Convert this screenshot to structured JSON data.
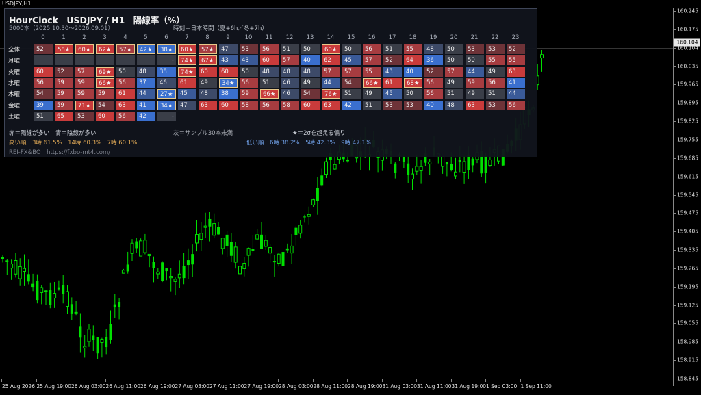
{
  "window": {
    "title": "USDJPY,H1"
  },
  "panel": {
    "title": "HourClock　USDJPY / H1　陽線率（%）",
    "subtitle": "5000本（2025.10.30〜2026.09.01）",
    "time_note": "時刻＝日本時間（夏+6h／冬+7h）",
    "hours": [
      "0",
      "1",
      "2",
      "3",
      "4",
      "5",
      "6",
      "7",
      "8",
      "9",
      "10",
      "11",
      "12",
      "13",
      "14",
      "15",
      "16",
      "17",
      "18",
      "19",
      "20",
      "21",
      "22",
      "23"
    ],
    "rows": [
      {
        "label": "全体",
        "cells": [
          {
            "t": "52",
            "c": "r1"
          },
          {
            "t": "58★",
            "c": "r3",
            "h": true
          },
          {
            "t": "60★",
            "c": "r3",
            "h": true
          },
          {
            "t": "62★",
            "c": "r3",
            "h": true
          },
          {
            "t": "57★",
            "c": "r2",
            "h": true
          },
          {
            "t": "42★",
            "c": "b3",
            "h": true
          },
          {
            "t": "38★",
            "c": "b3",
            "h": true
          },
          {
            "t": "60★",
            "c": "r3",
            "h": true
          },
          {
            "t": "57★",
            "c": "r2",
            "h": true
          },
          {
            "t": "47",
            "c": "b1"
          },
          {
            "t": "53",
            "c": "r1"
          },
          {
            "t": "56",
            "c": "r2"
          },
          {
            "t": "51",
            "c": "n"
          },
          {
            "t": "50",
            "c": "n"
          },
          {
            "t": "60★",
            "c": "r3",
            "h": true
          },
          {
            "t": "50",
            "c": "n"
          },
          {
            "t": "56",
            "c": "r2"
          },
          {
            "t": "51",
            "c": "n"
          },
          {
            "t": "55",
            "c": "r2"
          },
          {
            "t": "48",
            "c": "b1"
          },
          {
            "t": "50",
            "c": "n"
          },
          {
            "t": "53",
            "c": "r1"
          },
          {
            "t": "53",
            "c": "r1"
          },
          {
            "t": "52",
            "c": "r1"
          }
        ]
      },
      {
        "label": "月曜",
        "cells": [
          {
            "t": "",
            "c": "g"
          },
          {
            "t": "",
            "c": "g"
          },
          {
            "t": "",
            "c": "g"
          },
          {
            "t": "",
            "c": "g"
          },
          {
            "t": "",
            "c": "g"
          },
          {
            "t": "",
            "c": "g"
          },
          {
            "t": "-",
            "c": "g"
          },
          {
            "t": "74★",
            "c": "r3",
            "h": true
          },
          {
            "t": "67★",
            "c": "r3",
            "h": true
          },
          {
            "t": "43",
            "c": "b2"
          },
          {
            "t": "43",
            "c": "b2"
          },
          {
            "t": "60",
            "c": "r3"
          },
          {
            "t": "57",
            "c": "r2"
          },
          {
            "t": "40",
            "c": "b3"
          },
          {
            "t": "62",
            "c": "r3"
          },
          {
            "t": "45",
            "c": "b2"
          },
          {
            "t": "57",
            "c": "r2"
          },
          {
            "t": "52",
            "c": "r1"
          },
          {
            "t": "64",
            "c": "r3"
          },
          {
            "t": "36",
            "c": "b3"
          },
          {
            "t": "50",
            "c": "n"
          },
          {
            "t": "50",
            "c": "n"
          },
          {
            "t": "55",
            "c": "r2"
          },
          {
            "t": "55",
            "c": "r2"
          }
        ]
      },
      {
        "label": "火曜",
        "cells": [
          {
            "t": "60",
            "c": "r3"
          },
          {
            "t": "52",
            "c": "r1"
          },
          {
            "t": "57",
            "c": "r2"
          },
          {
            "t": "69★",
            "c": "r3",
            "h": true
          },
          {
            "t": "50",
            "c": "n"
          },
          {
            "t": "48",
            "c": "b1"
          },
          {
            "t": "38",
            "c": "b3"
          },
          {
            "t": "74★",
            "c": "r3",
            "h": true
          },
          {
            "t": "60",
            "c": "r3"
          },
          {
            "t": "60",
            "c": "r3"
          },
          {
            "t": "50",
            "c": "n"
          },
          {
            "t": "48",
            "c": "b1"
          },
          {
            "t": "48",
            "c": "b1"
          },
          {
            "t": "48",
            "c": "b1"
          },
          {
            "t": "57",
            "c": "r2"
          },
          {
            "t": "57",
            "c": "r2"
          },
          {
            "t": "55",
            "c": "r2"
          },
          {
            "t": "43",
            "c": "b2"
          },
          {
            "t": "40",
            "c": "b3"
          },
          {
            "t": "52",
            "c": "r1"
          },
          {
            "t": "57",
            "c": "r2"
          },
          {
            "t": "44",
            "c": "b2"
          },
          {
            "t": "49",
            "c": "n"
          },
          {
            "t": "63",
            "c": "r3"
          }
        ]
      },
      {
        "label": "水曜",
        "cells": [
          {
            "t": "56",
            "c": "r2"
          },
          {
            "t": "59",
            "c": "r2"
          },
          {
            "t": "59",
            "c": "r2"
          },
          {
            "t": "66★",
            "c": "r3",
            "h": true
          },
          {
            "t": "56",
            "c": "r2"
          },
          {
            "t": "37",
            "c": "b3"
          },
          {
            "t": "46",
            "c": "b1"
          },
          {
            "t": "61",
            "c": "r3"
          },
          {
            "t": "49",
            "c": "n"
          },
          {
            "t": "34★",
            "c": "b3",
            "h": true
          },
          {
            "t": "56",
            "c": "r2"
          },
          {
            "t": "51",
            "c": "n"
          },
          {
            "t": "46",
            "c": "b1"
          },
          {
            "t": "49",
            "c": "n"
          },
          {
            "t": "44",
            "c": "b2"
          },
          {
            "t": "54",
            "c": "r1"
          },
          {
            "t": "66★",
            "c": "r3",
            "h": true
          },
          {
            "t": "61",
            "c": "r3"
          },
          {
            "t": "68★",
            "c": "r3",
            "h": true
          },
          {
            "t": "56",
            "c": "r2"
          },
          {
            "t": "49",
            "c": "n"
          },
          {
            "t": "59",
            "c": "r2"
          },
          {
            "t": "56",
            "c": "r2"
          },
          {
            "t": "41",
            "c": "b3"
          }
        ]
      },
      {
        "label": "木曜",
        "cells": [
          {
            "t": "54",
            "c": "r1"
          },
          {
            "t": "59",
            "c": "r2"
          },
          {
            "t": "59",
            "c": "r2"
          },
          {
            "t": "59",
            "c": "r2"
          },
          {
            "t": "61",
            "c": "r3"
          },
          {
            "t": "44",
            "c": "b2"
          },
          {
            "t": "27★",
            "c": "b3",
            "h": true
          },
          {
            "t": "45",
            "c": "b2"
          },
          {
            "t": "48",
            "c": "b1"
          },
          {
            "t": "38",
            "c": "b3"
          },
          {
            "t": "59",
            "c": "r2"
          },
          {
            "t": "66★",
            "c": "r3",
            "h": true
          },
          {
            "t": "46",
            "c": "b1"
          },
          {
            "t": "54",
            "c": "r1"
          },
          {
            "t": "76★",
            "c": "r3",
            "h": true
          },
          {
            "t": "51",
            "c": "n"
          },
          {
            "t": "49",
            "c": "n"
          },
          {
            "t": "45",
            "c": "b2"
          },
          {
            "t": "50",
            "c": "n"
          },
          {
            "t": "56",
            "c": "r2"
          },
          {
            "t": "51",
            "c": "n"
          },
          {
            "t": "49",
            "c": "n"
          },
          {
            "t": "51",
            "c": "n"
          },
          {
            "t": "44",
            "c": "b2"
          }
        ]
      },
      {
        "label": "金曜",
        "cells": [
          {
            "t": "39",
            "c": "b3"
          },
          {
            "t": "59",
            "c": "r2"
          },
          {
            "t": "71★",
            "c": "r3",
            "h": true
          },
          {
            "t": "54",
            "c": "r1"
          },
          {
            "t": "63",
            "c": "r3"
          },
          {
            "t": "41",
            "c": "b3"
          },
          {
            "t": "34★",
            "c": "b3",
            "h": true
          },
          {
            "t": "47",
            "c": "b1"
          },
          {
            "t": "63",
            "c": "r3"
          },
          {
            "t": "60",
            "c": "r3"
          },
          {
            "t": "58",
            "c": "r2"
          },
          {
            "t": "56",
            "c": "r2"
          },
          {
            "t": "58",
            "c": "r2"
          },
          {
            "t": "60",
            "c": "r3"
          },
          {
            "t": "63",
            "c": "r3"
          },
          {
            "t": "42",
            "c": "b3"
          },
          {
            "t": "51",
            "c": "n"
          },
          {
            "t": "53",
            "c": "r1"
          },
          {
            "t": "53",
            "c": "r1"
          },
          {
            "t": "40",
            "c": "b3"
          },
          {
            "t": "48",
            "c": "b1"
          },
          {
            "t": "63",
            "c": "r3"
          },
          {
            "t": "53",
            "c": "r1"
          },
          {
            "t": "56",
            "c": "r2"
          }
        ]
      },
      {
        "label": "土曜",
        "cells": [
          {
            "t": "51",
            "c": "n"
          },
          {
            "t": "65",
            "c": "r3"
          },
          {
            "t": "53",
            "c": "r1"
          },
          {
            "t": "60",
            "c": "r3"
          },
          {
            "t": "56",
            "c": "r2"
          },
          {
            "t": "42",
            "c": "b3"
          },
          {
            "t": "-",
            "c": "g"
          },
          {
            "t": "",
            "c": "e"
          },
          {
            "t": "",
            "c": "e"
          },
          {
            "t": "",
            "c": "e"
          },
          {
            "t": "",
            "c": "e"
          },
          {
            "t": "",
            "c": "e"
          },
          {
            "t": "",
            "c": "e"
          },
          {
            "t": "",
            "c": "e"
          },
          {
            "t": "",
            "c": "e"
          },
          {
            "t": "",
            "c": "e"
          },
          {
            "t": "",
            "c": "e"
          },
          {
            "t": "",
            "c": "e"
          },
          {
            "t": "",
            "c": "e"
          },
          {
            "t": "",
            "c": "e"
          },
          {
            "t": "",
            "c": "e"
          },
          {
            "t": "",
            "c": "e"
          },
          {
            "t": "",
            "c": "e"
          },
          {
            "t": "",
            "c": "e"
          }
        ]
      }
    ],
    "legend": {
      "colors": "赤＝陽線が多い　青＝陰線が多い",
      "gray": "灰＝サンプル30本未満",
      "star": "★＝2σを超える偏り",
      "high": "高い順　3時 61.5%　14時 60.3%　7時 60.1%",
      "low": "低い順　6時 38.2%　5時 42.3%　9時 47.1%",
      "credit": "REI-FX&BO　https://fxbo-mt4.com/"
    }
  },
  "colors": {
    "r3": "#c93b3b",
    "r2": "#a63c40",
    "r1": "#6e3338",
    "n": "#3a3e48",
    "b1": "#3d4a68",
    "b2": "#3a5a98",
    "b3": "#3a6fce",
    "g": "#3a3e48",
    "candle": "#00e000",
    "highlight": "#e8c98a"
  },
  "price_axis": {
    "labels": [
      "160.245",
      "160.175",
      "160.104",
      "160.035",
      "159.965",
      "159.895",
      "159.825",
      "159.755",
      "159.685",
      "159.615",
      "159.545",
      "159.475",
      "159.405",
      "159.335",
      "159.265",
      "159.195",
      "159.125",
      "159.055",
      "158.985",
      "158.915",
      "158.845"
    ],
    "current": "160.104"
  },
  "time_axis": {
    "labels": [
      "25 Aug 2026",
      "25 Aug 19:00",
      "26 Aug 03:00",
      "26 Aug 11:00",
      "26 Aug 19:00",
      "27 Aug 03:00",
      "27 Aug 11:00",
      "27 Aug 19:00",
      "28 Aug 03:00",
      "28 Aug 11:00",
      "28 Aug 19:00",
      "31 Aug 03:00",
      "31 Aug 11:00",
      "31 Aug 19:00",
      "1 Sep 03:00",
      "1 Sep 11:00"
    ]
  }
}
